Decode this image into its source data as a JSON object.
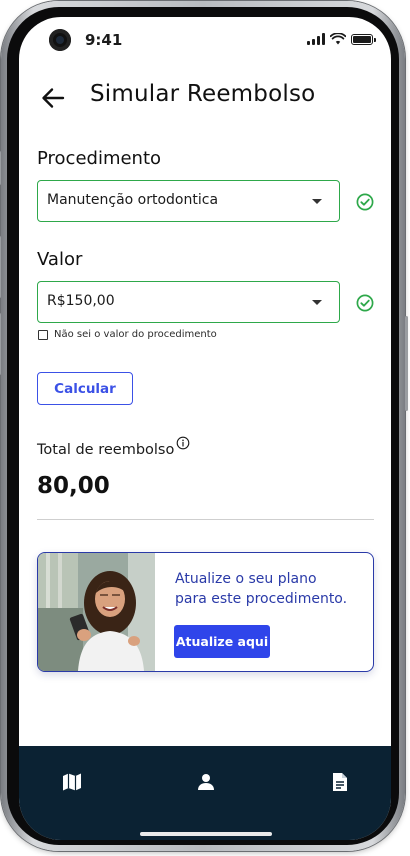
{
  "status_bar": {
    "time": "9:41"
  },
  "header": {
    "title": "Simular Reembolso",
    "back_icon": "arrow-left-icon"
  },
  "form": {
    "procedimento": {
      "label": "Procedimento",
      "value": "Manutenção ortodontica",
      "status": "valid"
    },
    "valor": {
      "label": "Valor",
      "value": "R$150,00",
      "status": "valid"
    },
    "unknown_value_checkbox": {
      "label": "Não sei o valor do procedimento",
      "checked": false
    },
    "calculate_label": "Calcular"
  },
  "result": {
    "label": "Total de reembolso",
    "value": "80,00"
  },
  "promo": {
    "text_line1": "Atualize o seu plano",
    "text_line2": "para este procedimento.",
    "button_label": "Atualize aqui"
  },
  "bottom_nav": {
    "items": [
      {
        "icon": "map-icon"
      },
      {
        "icon": "person-icon"
      },
      {
        "icon": "document-icon"
      }
    ]
  },
  "colors": {
    "accent": "#3b51e6",
    "success": "#2ea84a",
    "promo_text": "#2a3aa8",
    "nav_background": "#0b2233"
  }
}
